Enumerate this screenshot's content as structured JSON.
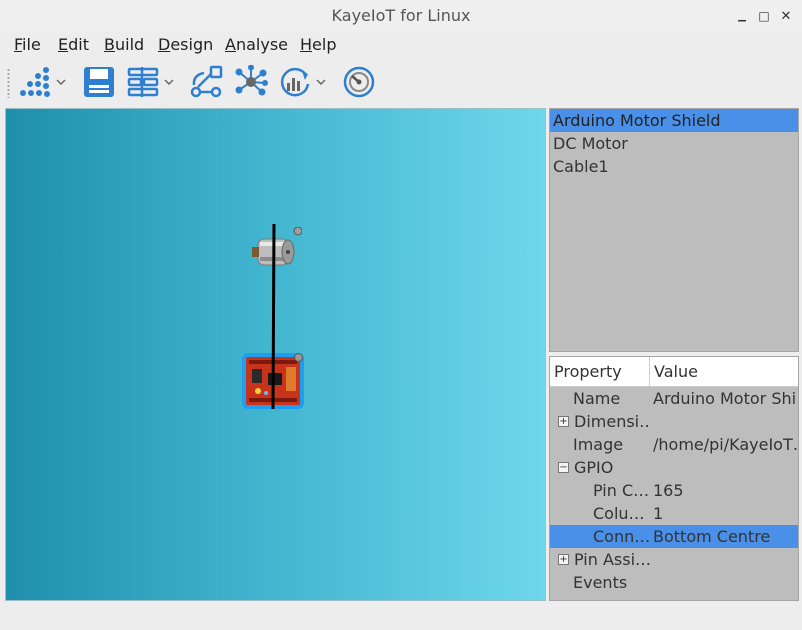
{
  "window": {
    "title": "KayeIoT for Linux",
    "minimize_glyph": "▁",
    "maximize_glyph": "□",
    "close_glyph": "✕"
  },
  "menu": [
    {
      "mnemonic": "F",
      "rest": "ile"
    },
    {
      "mnemonic": "E",
      "rest": "dit"
    },
    {
      "mnemonic": "B",
      "rest": "uild"
    },
    {
      "mnemonic": "D",
      "rest": "esign"
    },
    {
      "mnemonic": "A",
      "rest": "nalyse"
    },
    {
      "mnemonic": "H",
      "rest": "elp"
    }
  ],
  "toolbar": {
    "icons": [
      "dots-grid-icon",
      "save-icon",
      "tree-list-icon",
      "flow-graph-icon",
      "network-icon",
      "sync-chart-icon",
      "speedometer-icon"
    ],
    "accent": "#3a8fd8"
  },
  "canvas": {
    "gradient_start": "#1f8fab",
    "gradient_end": "#6fd7eb",
    "components": [
      "dc-motor",
      "arduino-motor-shield",
      "cable"
    ]
  },
  "components_list": {
    "items": [
      "Arduino Motor Shield",
      "DC Motor",
      "Cable1"
    ],
    "selected_index": 0
  },
  "properties": {
    "header_property": "Property",
    "header_value": "Value",
    "rows": [
      {
        "key": "Name",
        "value": "Arduino Motor Shi…",
        "expander": ""
      },
      {
        "key": "Dimensi…",
        "value": "",
        "expander": "+"
      },
      {
        "key": "Image",
        "value": "/home/pi/KayeIoT…",
        "expander": ""
      },
      {
        "key": "GPIO",
        "value": "",
        "expander": "−"
      },
      {
        "key": "Pin C…",
        "value": "165",
        "expander": ""
      },
      {
        "key": "Colu…",
        "value": "1",
        "expander": ""
      },
      {
        "key": "Conn…",
        "value": "Bottom Centre",
        "expander": ""
      },
      {
        "key": "Pin Assi…",
        "value": "",
        "expander": "+"
      },
      {
        "key": "Events",
        "value": "",
        "expander": ""
      }
    ],
    "selected_index": 6
  },
  "colors": {
    "selection": "#4a90e8",
    "panel": "#bdbdbd"
  }
}
